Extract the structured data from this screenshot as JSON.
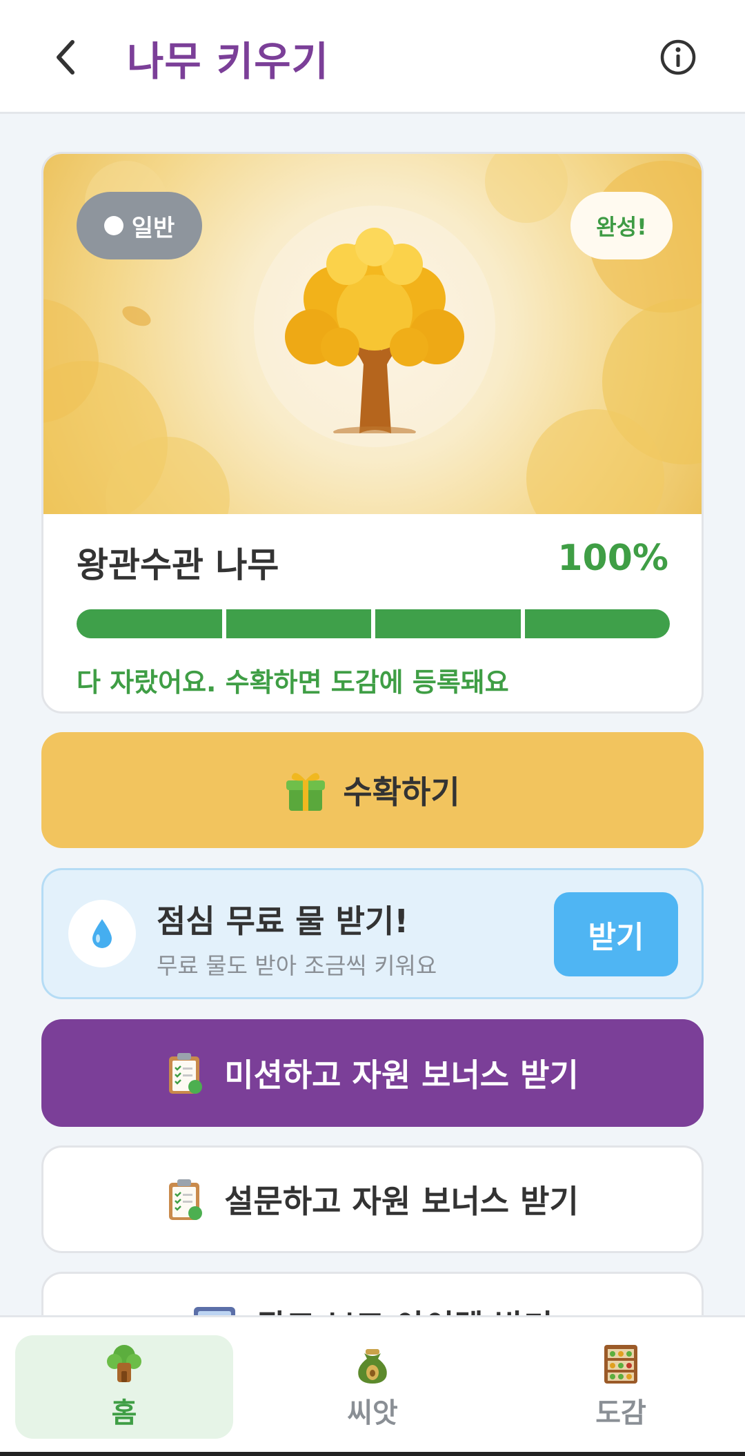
{
  "header": {
    "title": "나무 키우기",
    "back_icon": "chevron-left-icon",
    "info_icon": "info-circle-icon"
  },
  "tree_card": {
    "grade_label": "일반",
    "complete_label": "완성!",
    "tree_name": "왕관수관 나무",
    "progress_percent_label": "100%",
    "progress_fraction": 1.0,
    "progress_segments": 4,
    "message": "다 자랐어요. 수확하면 도감에 등록돼요"
  },
  "harvest": {
    "label": "수확하기",
    "icon": "gift-icon"
  },
  "water": {
    "title": "점심 무료 물 받기!",
    "subtitle": "무료 물도 받아 조금씩 키워요",
    "button_label": "받기",
    "icon": "water-drop-icon"
  },
  "mission": {
    "label": "미션하고 자원 보너스 받기",
    "icon": "clipboard-icon"
  },
  "survey": {
    "label": "설문하고 자원 보너스 받기",
    "icon": "clipboard-icon"
  },
  "partial": {
    "label": "광고 보고 아이템 받기"
  },
  "bottom_nav": {
    "items": [
      {
        "label": "홈",
        "icon": "treehouse-icon",
        "active": true
      },
      {
        "label": "씨앗",
        "icon": "seed-bag-icon",
        "active": false
      },
      {
        "label": "도감",
        "icon": "bookshelf-icon",
        "active": false
      }
    ]
  },
  "colors": {
    "brand_purple": "#7b3f98",
    "success_green": "#3f9e45",
    "harvest_yellow": "#f2c45e",
    "water_blue": "#4fb5f3"
  }
}
